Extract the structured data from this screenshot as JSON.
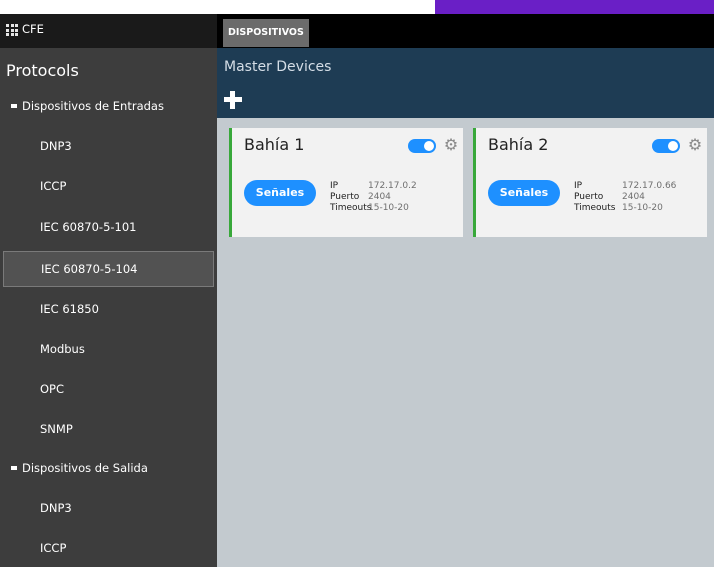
{
  "app": {
    "title": "CFE"
  },
  "sidebar": {
    "title": "Protocols",
    "groups": [
      {
        "label": "Dispositivos de Entradas",
        "items": [
          "DNP3",
          "ICCP",
          "IEC 60870-5-101",
          "IEC 60870-5-104",
          "IEC 61850",
          "Modbus",
          "OPC",
          "SNMP"
        ]
      },
      {
        "label": "Dispositivos de Salida",
        "items": [
          "DNP3",
          "ICCP"
        ]
      }
    ],
    "selected_item": "IEC 60870-5-104"
  },
  "tabs": [
    {
      "label": "DISPOSITIVOS",
      "active": true
    }
  ],
  "main": {
    "section_title": "Master Devices"
  },
  "devices": [
    {
      "name": "Bahía 1",
      "enabled": true,
      "button": "Señales",
      "fields": {
        "ip_label": "IP",
        "ip": "172.17.0.2",
        "port_label": "Puerto",
        "port": "2404",
        "timeouts_label": "Timeouts",
        "timeouts": "15-10-20"
      }
    },
    {
      "name": "Bahía 2",
      "enabled": true,
      "button": "Señales",
      "fields": {
        "ip_label": "IP",
        "ip": "172.17.0.66",
        "port_label": "Puerto",
        "port": "2404",
        "timeouts_label": "Timeouts",
        "timeouts": "15-10-20"
      }
    }
  ],
  "colors": {
    "accent": "#1e90ff",
    "status_bar": "#38a83a",
    "header": "#1e3c54",
    "purple": "#6a1fc6"
  },
  "icons": {
    "app": "grid-icon",
    "add": "plus-icon",
    "settings": "gear-icon",
    "toggle": "toggle-switch"
  }
}
